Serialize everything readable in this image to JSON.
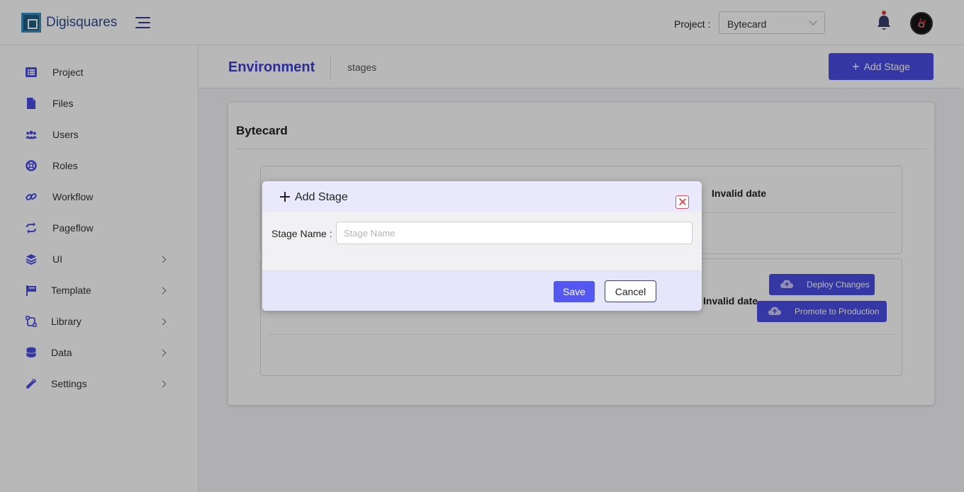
{
  "header": {
    "brand": "Digisquares",
    "project_label": "Project :",
    "project_value": "Bytecard"
  },
  "sidebar": {
    "items": [
      {
        "label": "Project",
        "icon": "list-icon",
        "has_children": false
      },
      {
        "label": "Files",
        "icon": "file-icon",
        "has_children": false
      },
      {
        "label": "Users",
        "icon": "users-icon",
        "has_children": false
      },
      {
        "label": "Roles",
        "icon": "lifebuoy-icon",
        "has_children": false
      },
      {
        "label": "Workflow",
        "icon": "link-icon",
        "has_children": false
      },
      {
        "label": "Pageflow",
        "icon": "sync-icon",
        "has_children": false
      },
      {
        "label": "UI",
        "icon": "layers-icon",
        "has_children": true
      },
      {
        "label": "Template",
        "icon": "flag-icon",
        "has_children": true
      },
      {
        "label": "Library",
        "icon": "library-icon",
        "has_children": true
      },
      {
        "label": "Data",
        "icon": "database-icon",
        "has_children": true
      },
      {
        "label": "Settings",
        "icon": "wrench-icon",
        "has_children": true
      }
    ]
  },
  "page": {
    "title": "Environment",
    "subtitle": "stages",
    "add_stage_label": "Add Stage"
  },
  "card": {
    "title": "Bytecard",
    "stages": [
      {
        "date": "Invalid date"
      },
      {
        "date": "Invalid date",
        "deploy_label": "Deploy Changes",
        "promote_label": "Promote to Production"
      }
    ]
  },
  "modal": {
    "title": "Add Stage",
    "field_label": "Stage Name :",
    "field_placeholder": "Stage Name",
    "field_value": "",
    "save_label": "Save",
    "cancel_label": "Cancel"
  },
  "colors": {
    "accent": "#4a4ee3",
    "title": "#3b3fcf",
    "close": "#e0505a"
  }
}
